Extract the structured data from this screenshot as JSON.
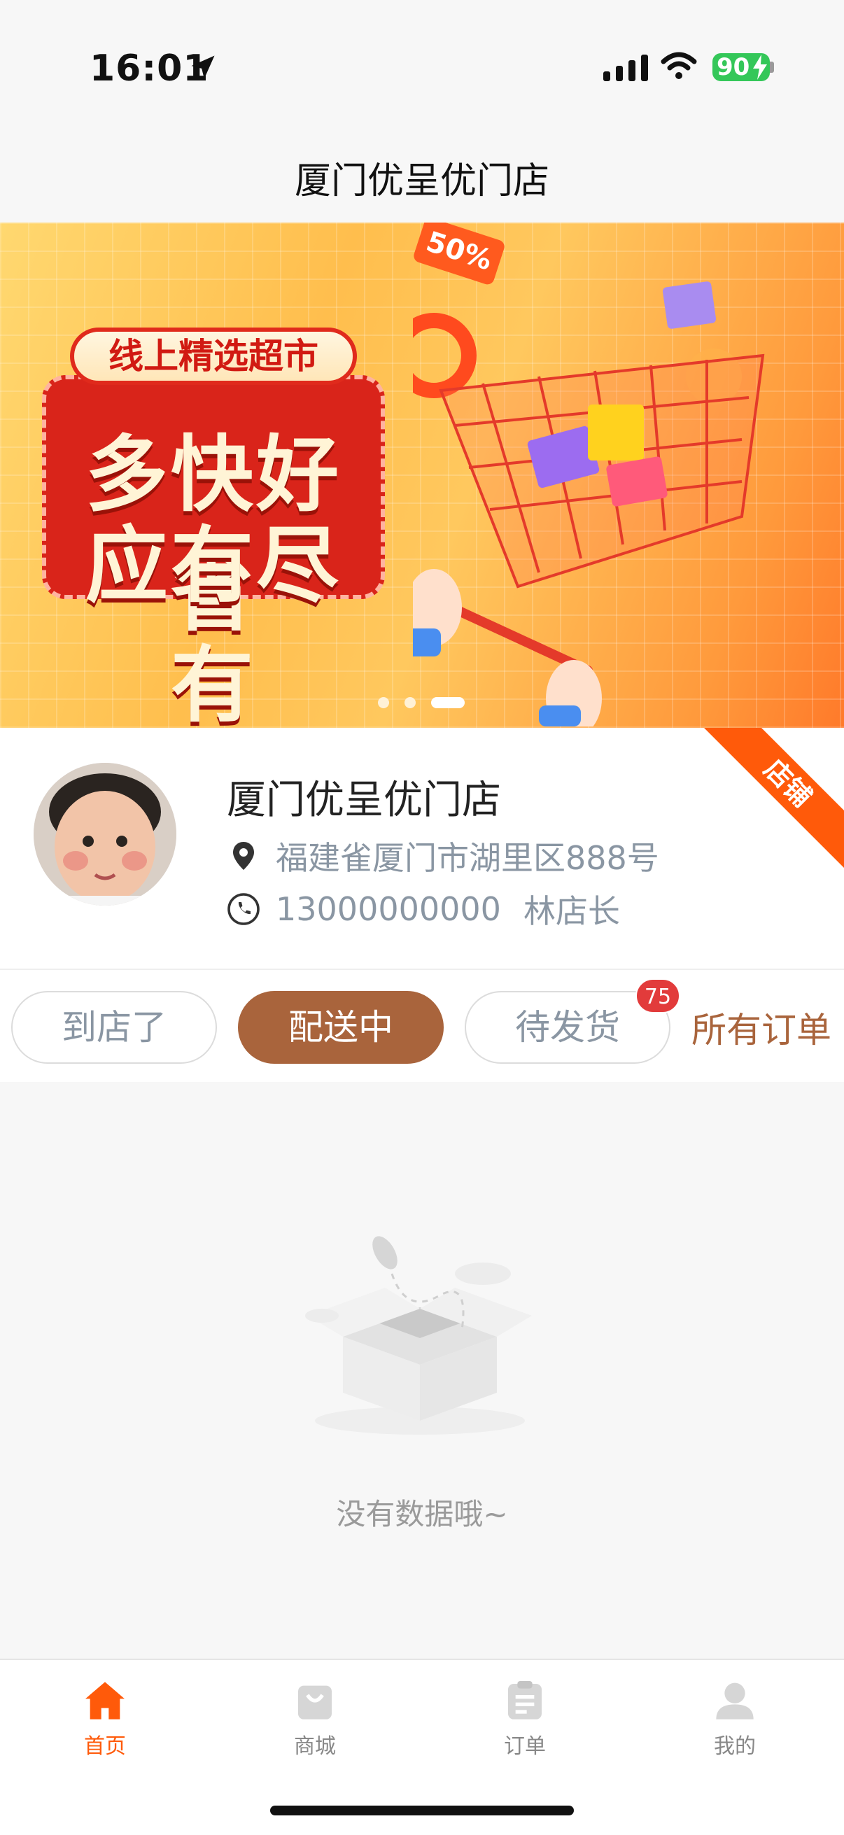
{
  "status_bar": {
    "time": "16:01",
    "battery": "90"
  },
  "header": {
    "title": "厦门优呈优门店"
  },
  "banner": {
    "badge": "线上精选超市",
    "headline_line1": "多快好省",
    "headline_line2": "应有尽有",
    "discount_tag": "50%",
    "dot_count": 3,
    "active_dot": 2
  },
  "store": {
    "name": "厦门优呈优门店",
    "address": "福建雀厦门市湖里区888号",
    "phone": "13000000000",
    "manager": "林店长",
    "ribbon": "店铺"
  },
  "tabs": [
    {
      "label": "到店了",
      "active": false
    },
    {
      "label": "配送中",
      "active": true
    },
    {
      "label": "待发货",
      "active": false,
      "badge": "75"
    }
  ],
  "all_orders_label": "所有订单",
  "empty_state": {
    "text": "没有数据哦~"
  },
  "bottom_nav": [
    {
      "label": "首页",
      "icon": "home-icon",
      "active": true
    },
    {
      "label": "商城",
      "icon": "shopping-bag-icon",
      "active": false
    },
    {
      "label": "订单",
      "icon": "clipboard-icon",
      "active": false
    },
    {
      "label": "我的",
      "icon": "user-icon",
      "active": false
    }
  ],
  "colors": {
    "accent": "#a9643c",
    "nav_active": "#ff5a0a",
    "badge": "#e23b3b"
  }
}
